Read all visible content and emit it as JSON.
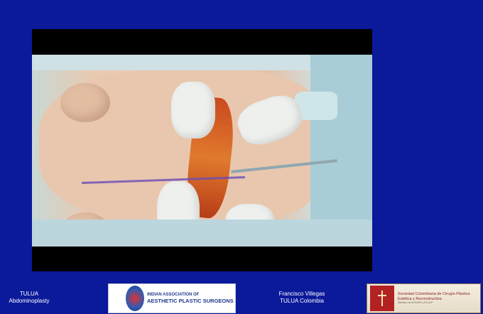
{
  "video": {
    "alt": "Surgical video frame"
  },
  "footer": {
    "left_line1": "TULUA",
    "left_line2": "Abdominoplasty",
    "middle_line1": "Francisco Villegas",
    "middle_line2": "TULUA Colombia",
    "iaaps_logo": {
      "line1": "INDIAN ASSOCIATION OF",
      "line2": "AESTHETIC PLASTIC SURGEONS"
    },
    "scc_logo": {
      "line1": "Sociedad Colombiana de Cirugía Plástica",
      "line2": "Estética y Reconstructiva",
      "line3": "Miembro de la ISAPS y FILACP"
    }
  },
  "colors": {
    "background": "#0b1a9a",
    "text": "#ffffff"
  }
}
